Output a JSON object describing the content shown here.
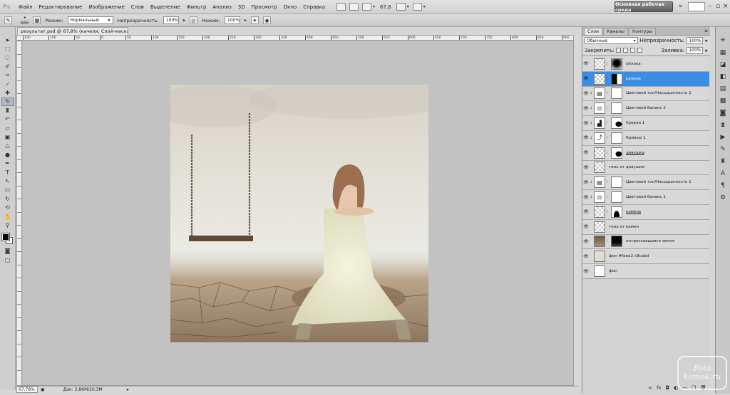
{
  "app": {
    "logo": "Ps",
    "window_title": "Adobe Photoshop"
  },
  "menu": [
    "Файл",
    "Редактирование",
    "Изображение",
    "Слои",
    "Выделение",
    "Фильтр",
    "Анализ",
    "3D",
    "Просмотр",
    "Окно",
    "Справка"
  ],
  "menubar": {
    "zoom": "67,8",
    "workspace": "Основная рабочая среда",
    "more": "»"
  },
  "options": {
    "brush_size": "666",
    "mode_label": "Режим:",
    "mode_value": "Нормальный",
    "opacity_label": "Непрозрачность:",
    "opacity_value": "100%",
    "flow_label": "Нажим:",
    "flow_value": "100%"
  },
  "document": {
    "tab_title": "результат.psd @ 67,8% (качели, Слой-маска/8) *",
    "zoom": "67,78%",
    "info": "Док: 2,86M/20,3M",
    "ruler_labels": [
      "150",
      "100",
      "50",
      "0",
      "50",
      "100",
      "150",
      "200",
      "250",
      "300",
      "350",
      "400",
      "450",
      "500",
      "550",
      "600",
      "650",
      "700",
      "750",
      "800",
      "850",
      "900"
    ]
  },
  "tools": [
    "move-tool",
    "marquee-tool",
    "lasso-tool",
    "quick-select-tool",
    "crop-tool",
    "eyedropper-tool",
    "healing-tool",
    "brush-tool",
    "stamp-tool",
    "history-brush-tool",
    "eraser-tool",
    "gradient-tool",
    "blur-tool",
    "dodge-tool",
    "pen-tool",
    "type-tool",
    "path-select-tool",
    "shape-tool",
    "3d-rotate-tool",
    "3d-orbit-tool",
    "hand-tool",
    "zoom-tool"
  ],
  "layers_panel": {
    "tabs": [
      "Слои",
      "Каналы",
      "Контуры"
    ],
    "blend_mode": "Обычные",
    "opacity_label": "Непрозрачность:",
    "opacity_value": "100%",
    "lock_label": "Закрепить:",
    "fill_label": "Заливка:",
    "fill_value": "100%",
    "layers": [
      {
        "name": "облака",
        "thumb": "trans",
        "mask": "cloud",
        "underline": false,
        "selected": false,
        "clipped": false
      },
      {
        "name": "качели",
        "thumb": "trans",
        "mask": "swingmask",
        "underline": false,
        "selected": true,
        "clipped": false
      },
      {
        "name": "Цветовой тон/Насыщенность 2",
        "thumb": "adj",
        "adj_glyph": "▤",
        "mask": "white",
        "underline": false,
        "selected": false,
        "clipped": true
      },
      {
        "name": "Цветовой баланс 2",
        "thumb": "adj",
        "adj_glyph": "⚖",
        "mask": "white",
        "underline": false,
        "selected": false,
        "clipped": true
      },
      {
        "name": "Уровни 1",
        "thumb": "adj",
        "adj_glyph": "▟",
        "mask": "wmask",
        "underline": false,
        "selected": false,
        "clipped": true
      },
      {
        "name": "Кривые 1",
        "thumb": "adj",
        "adj_glyph": "⤴",
        "mask": "white",
        "underline": false,
        "selected": false,
        "clipped": true
      },
      {
        "name": "девушка",
        "thumb": "trans",
        "mask": "wmask",
        "underline": true,
        "selected": false,
        "clipped": false
      },
      {
        "name": "тень от девушки",
        "thumb": "trans",
        "mask": "",
        "underline": false,
        "selected": false,
        "clipped": false
      },
      {
        "name": "Цветовой тон/Насыщенность 1",
        "thumb": "adj",
        "adj_glyph": "▤",
        "mask": "white",
        "underline": false,
        "selected": false,
        "clipped": true
      },
      {
        "name": "Цветовой баланс 1",
        "thumb": "adj",
        "adj_glyph": "⚖",
        "mask": "white",
        "underline": false,
        "selected": false,
        "clipped": true
      },
      {
        "name": "камень",
        "thumb": "trans",
        "mask": "rockmask",
        "underline": true,
        "selected": false,
        "clipped": false
      },
      {
        "name": "тень от камня",
        "thumb": "trans",
        "mask": "",
        "underline": false,
        "selected": false,
        "clipped": false
      },
      {
        "name": "потрескавшаяся земля",
        "thumb": "cracks",
        "mask": "blk",
        "underline": false,
        "selected": false,
        "clipped": false
      },
      {
        "name": "фон #faea2 c8cabd",
        "thumb": "beige",
        "mask": "",
        "underline": false,
        "selected": false,
        "clipped": false
      },
      {
        "name": "фон",
        "thumb": "white",
        "mask": "",
        "underline": false,
        "selected": false,
        "clipped": false
      }
    ]
  },
  "watermark": {
    "line1": "Foto",
    "line2": "komok.ru"
  },
  "colors": {
    "accent": "#3a8ee6",
    "foreground": "#000000",
    "background": "#ffffff"
  }
}
